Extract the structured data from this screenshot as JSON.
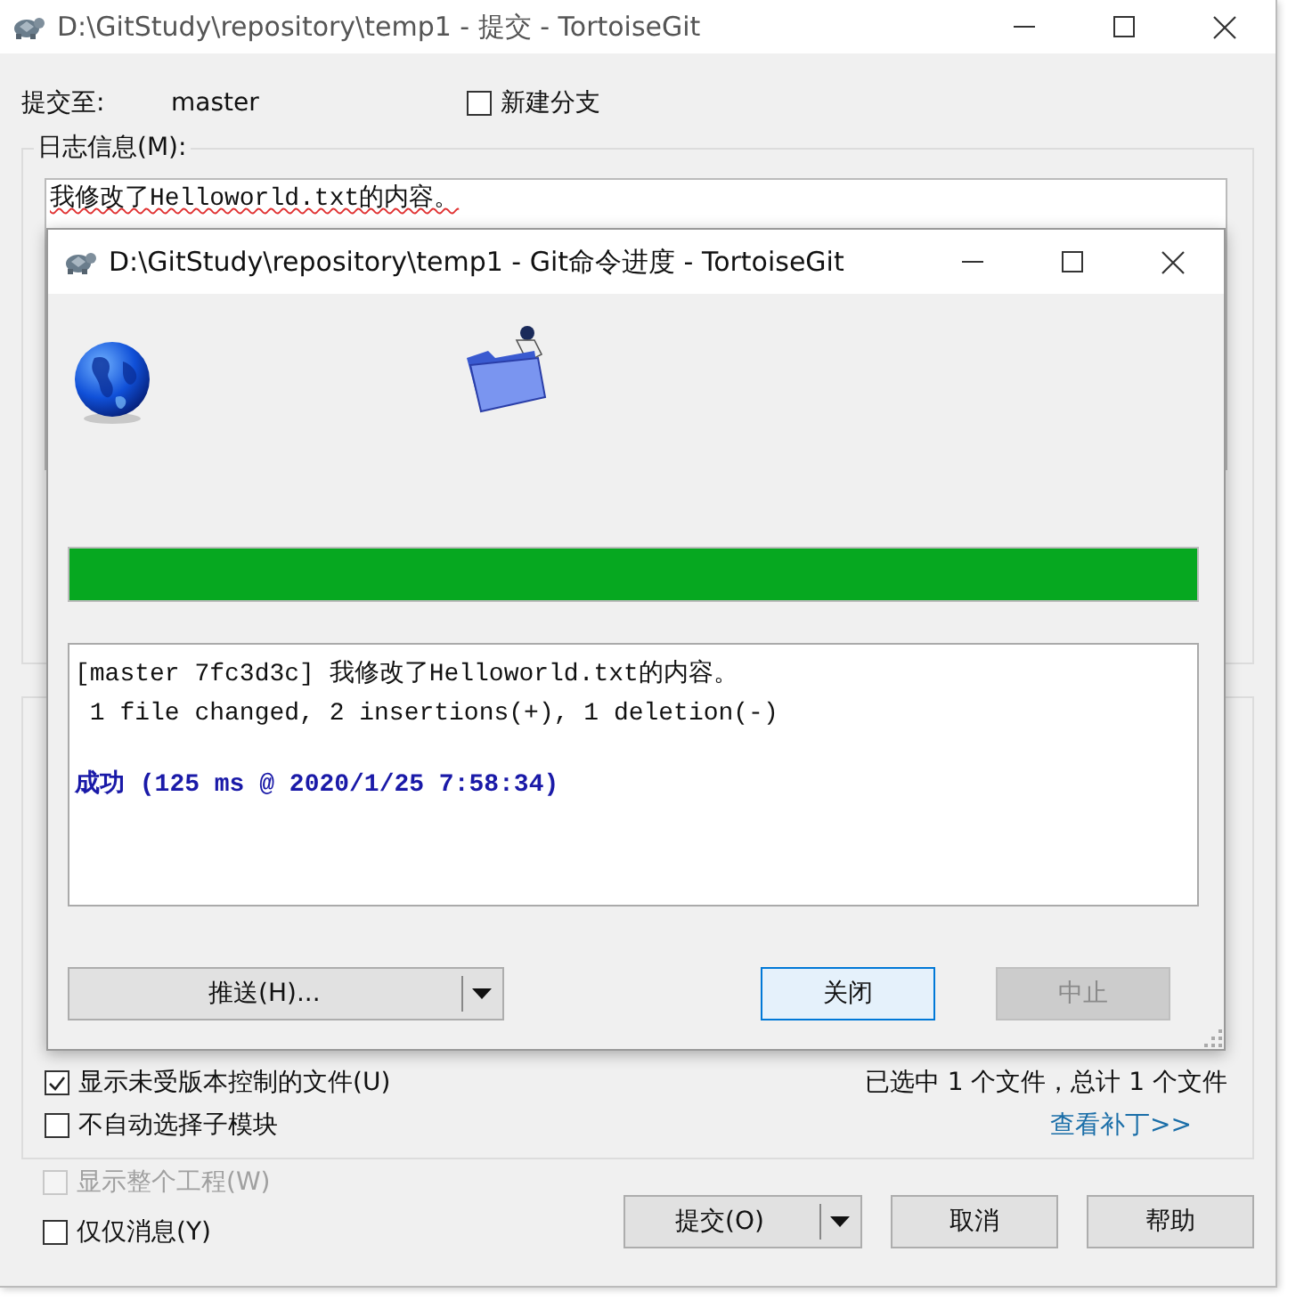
{
  "window": {
    "title": "D:\\GitStudy\\repository\\temp1 - 提交 - TortoiseGit"
  },
  "commit_to": {
    "label": "提交至:",
    "branch": "master"
  },
  "new_branch": {
    "label": "新建分支",
    "checked": false
  },
  "message_group": {
    "label": "日志信息(M):",
    "message": "我修改了Helloworld.txt的内容。"
  },
  "options": [
    {
      "label": "显示未受版本控制的文件(U)",
      "checked": true,
      "disabled": false
    },
    {
      "label": "不自动选择子模块",
      "checked": false,
      "disabled": false
    }
  ],
  "selection_summary": "已选中 1 个文件，总计 1 个文件",
  "view_patch_link": "查看补丁>>",
  "bottom_options": [
    {
      "label": "显示整个工程(W)",
      "checked": false,
      "disabled": true
    },
    {
      "label": "仅仅消息(Y)",
      "checked": false,
      "disabled": false
    }
  ],
  "buttons": [
    {
      "label": "提交(O)",
      "kind": "split"
    },
    {
      "label": "取消",
      "kind": "plain"
    },
    {
      "label": "帮助",
      "kind": "plain"
    }
  ],
  "progress_dialog": {
    "title": "D:\\GitStudy\\repository\\temp1 - Git命令进度 - TortoiseGit",
    "level": 1,
    "log": [
      {
        "text": "[master 7fc3d3c] 我修改了Helloworld.txt的内容。",
        "kind": "output"
      },
      {
        "text": " 1 file changed, 2 insertions(+), 1 deletion(-)",
        "kind": "output"
      },
      {
        "text": "成功 (125 ms @ 2020/1/25 7:58:34)",
        "kind": "success"
      }
    ],
    "buttons": [
      {
        "label": "推送(H)...",
        "kind": "split",
        "focused": false,
        "disabled": false
      },
      {
        "label": "关闭",
        "kind": "plain",
        "focused": true,
        "disabled": false
      },
      {
        "label": "中止",
        "kind": "plain",
        "focused": false,
        "disabled": true
      }
    ]
  }
}
